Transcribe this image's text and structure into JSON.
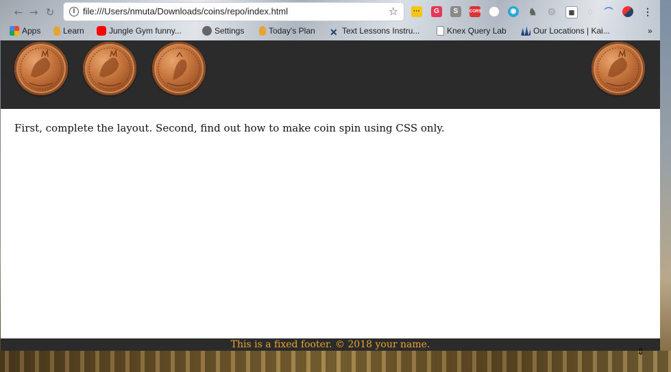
{
  "browser": {
    "url": "file:///Users/nmuta/Downloads/coins/repo/index.html",
    "bookmarks": [
      {
        "label": "Apps",
        "icon": "apps-grid-icon",
        "color": "#e8453c"
      },
      {
        "label": "Learn",
        "icon": "hand-icon",
        "color": "#e8a430"
      },
      {
        "label": "Jungle Gym funny...",
        "icon": "youtube-icon",
        "color": "#ff0000"
      },
      {
        "label": "Settings",
        "icon": "gear-icon",
        "color": "#666666"
      },
      {
        "label": "Today's Plan",
        "icon": "hand-icon",
        "color": "#e8a430"
      },
      {
        "label": "Text Lessons Instru...",
        "icon": "x-logo-icon",
        "color": "#1b3a6b"
      },
      {
        "label": "Knex Query Lab",
        "icon": "file-icon",
        "color": "#888888"
      },
      {
        "label": "Our Locations | Kai...",
        "icon": "building-icon",
        "color": "#3a6fb0"
      }
    ],
    "more_label": "»"
  },
  "page": {
    "content_text": "First, complete the layout. Second, find out how to make coin spin using CSS only.",
    "footer_text": "This is a fixed footer. © 2018 your name."
  },
  "colors": {
    "header_bg": "#2b2b2b",
    "footer_text": "#e8a430",
    "coin": "#c8773f"
  }
}
